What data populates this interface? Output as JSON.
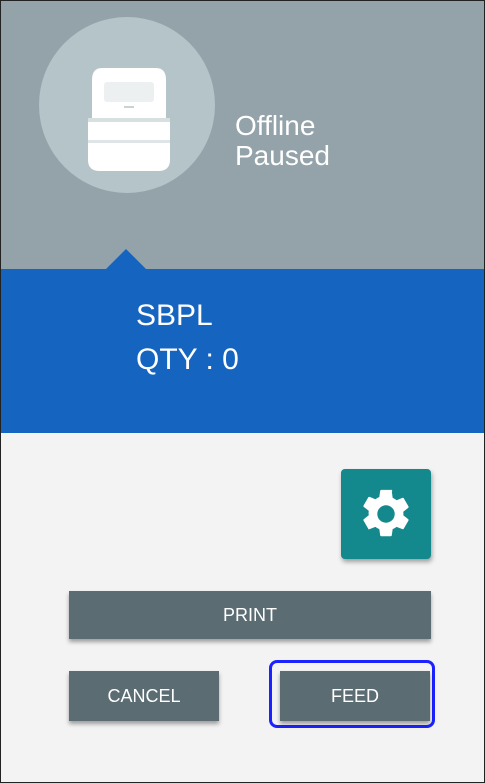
{
  "printer_status": {
    "icon": "printer-icon",
    "line1": "Offline",
    "line2": "Paused"
  },
  "info": {
    "language": "SBPL",
    "quantity": "QTY : 0"
  },
  "settings": {
    "icon": "gear-icon"
  },
  "actions": {
    "print_label": "PRINT",
    "cancel_label": "CANCEL",
    "feed_label": "FEED"
  },
  "colors": {
    "header_bg": "#94a3a9",
    "circle_bg": "#b5c4c8",
    "info_bg": "#1565c0",
    "settings_bg": "#13888d",
    "button_bg": "#5b6c73",
    "focus_ring": "#1a23ff"
  }
}
